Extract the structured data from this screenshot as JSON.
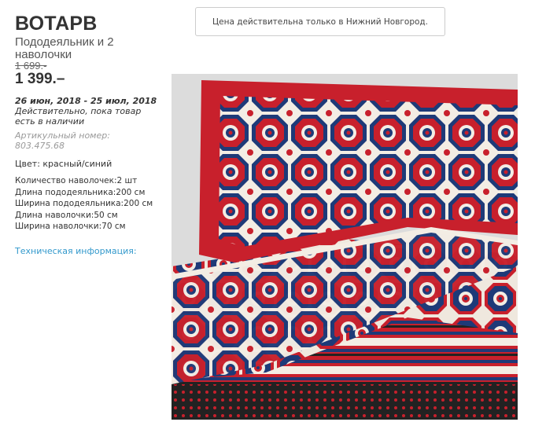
{
  "product": {
    "name": "ВОТАРВ",
    "description": "Пододеяльник и 2 наволочки",
    "old_price": "1 699.-",
    "price": "1 399.–",
    "validity_dates": "26 июн, 2018 - 25 июл, 2018",
    "validity_note": " Действительно, пока товар есть в наличии",
    "article": "Артикульный номер: 803.475.68",
    "color": "Цвет: красный/синий",
    "specs": [
      "Количество наволочек:2 шт",
      "Длина пододеяльника:200 см",
      "Ширина пододеяльника:200 см",
      "Длина наволочки:50 см",
      "Ширина наволочки:70 см"
    ],
    "tech_link": "Техническая информация:"
  },
  "notice": {
    "text": "Цена действительна только в Нижний Новгород."
  },
  "image": {
    "icon": "bedding-pattern-image",
    "colors": {
      "red": "#c8202c",
      "navy": "#1e3a78",
      "cream": "#f3ede4",
      "background": "#dcdcdc"
    }
  }
}
